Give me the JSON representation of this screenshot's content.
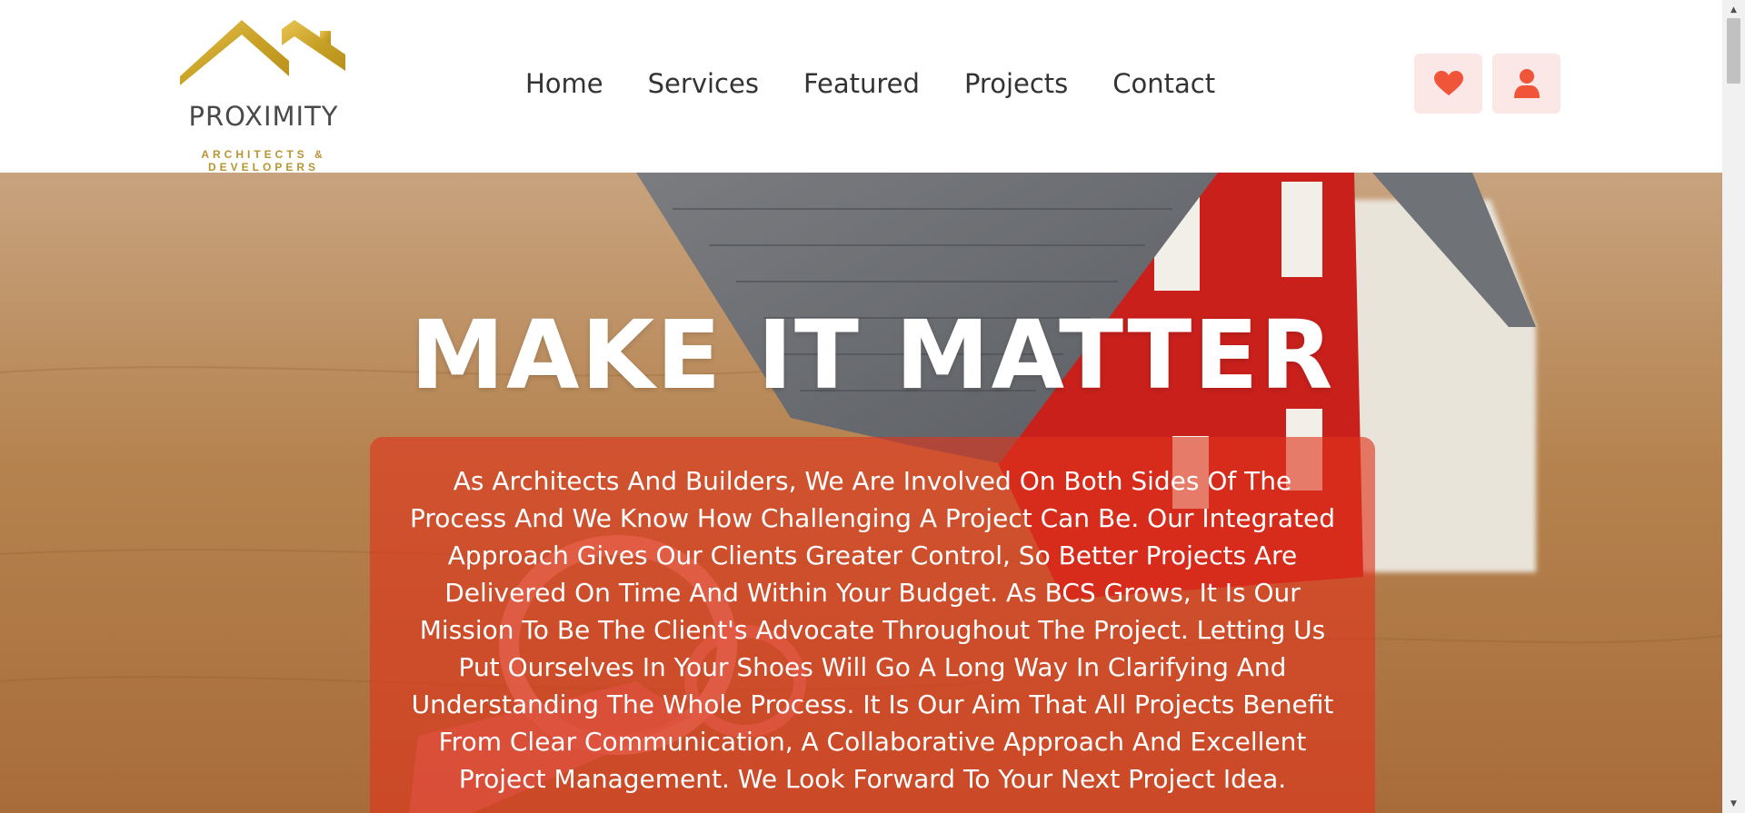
{
  "brand": {
    "name": "PROXIMITY",
    "tagline": "ARCHITECTS & DEVELOPERS",
    "logo_icon": "roof-logo-icon"
  },
  "nav": {
    "items": [
      {
        "label": "Home"
      },
      {
        "label": "Services"
      },
      {
        "label": "Featured"
      },
      {
        "label": "Projects"
      },
      {
        "label": "Contact"
      }
    ]
  },
  "actions": {
    "wishlist_icon": "heart-icon",
    "account_icon": "user-icon"
  },
  "hero": {
    "title": "MAKE IT MATTER",
    "body": "As Architects And Builders, We Are Involved On Both Sides Of The Process And We Know How Challenging A Project Can Be. Our Integrated Approach Gives Our Clients Greater Control, So Better Projects Are Delivered On Time And Within Your Budget. As BCS Grows, It Is Our Mission To Be The Client's Advocate Throughout The Project. Letting Us Put Ourselves In Your Shoes Will Go A Long Way In Clarifying And Understanding The Whole Process. It Is Our Aim That All Projects Benefit From Clear Communication, A Collaborative Approach And Excellent Project Management. We Look Forward To Your Next Project Idea."
  },
  "colors": {
    "accent": "#f0553a",
    "gold": "#c9a227",
    "card_overlay": "#e0341c",
    "icon_button_bg": "#fbe8e6"
  }
}
